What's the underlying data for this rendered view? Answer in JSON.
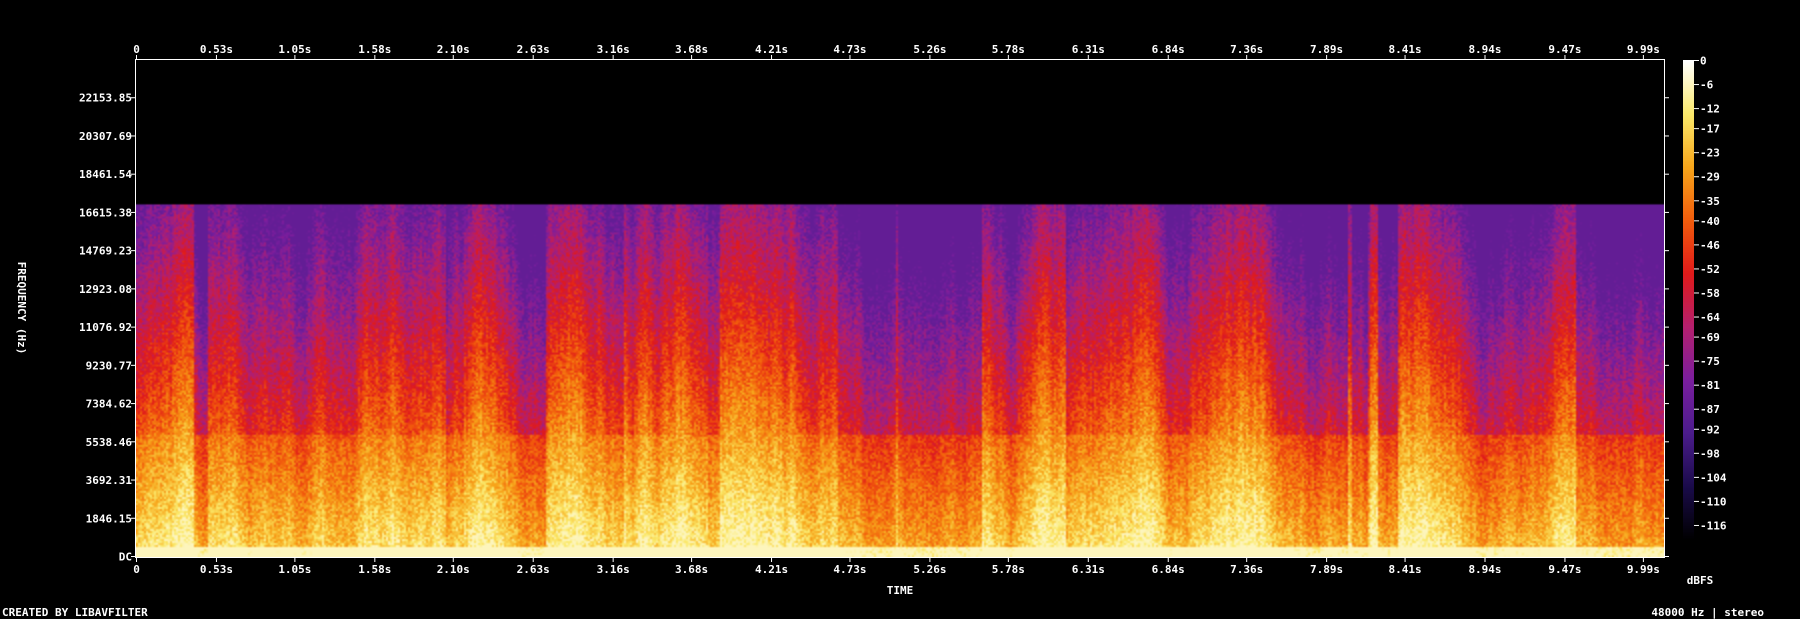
{
  "chart_data": {
    "type": "heatmap",
    "xlabel": "TIME",
    "ylabel": "FREQUENCY (Hz)",
    "x_ticks": [
      "0",
      "0.53s",
      "1.05s",
      "1.58s",
      "2.10s",
      "2.63s",
      "3.16s",
      "3.68s",
      "4.21s",
      "4.73s",
      "5.26s",
      "5.78s",
      "6.31s",
      "6.84s",
      "7.36s",
      "7.89s",
      "8.41s",
      "8.94s",
      "9.47s",
      "9.99s"
    ],
    "x_tick_values": [
      0,
      0.53,
      1.05,
      1.58,
      2.1,
      2.63,
      3.16,
      3.68,
      4.21,
      4.73,
      5.26,
      5.78,
      6.31,
      6.84,
      7.36,
      7.89,
      8.41,
      8.94,
      9.47,
      9.99
    ],
    "x_range": [
      0,
      10.13
    ],
    "y_ticks": [
      "DC",
      "1846.15",
      "3692.31",
      "5538.46",
      "7384.62",
      "9230.77",
      "11076.92",
      "12923.08",
      "14769.23",
      "16615.38",
      "18461.54",
      "20307.69",
      "22153.85"
    ],
    "y_tick_values": [
      0,
      1846.15,
      3692.31,
      5538.46,
      7384.62,
      9230.77,
      11076.92,
      12923.08,
      14769.23,
      16615.38,
      18461.54,
      20307.69,
      22153.85
    ],
    "y_range": [
      0,
      24000
    ],
    "cutoff_frequency": 17000,
    "color_scale": {
      "unit": "dBFS",
      "ticks": [
        "0",
        "-6",
        "-12",
        "-17",
        "-23",
        "-29",
        "-35",
        "-40",
        "-46",
        "-52",
        "-58",
        "-64",
        "-69",
        "-75",
        "-81",
        "-87",
        "-92",
        "-98",
        "-104",
        "-110",
        "-116"
      ],
      "tick_values": [
        0,
        -6,
        -12,
        -17,
        -23,
        -29,
        -35,
        -40,
        -46,
        -52,
        -58,
        -64,
        -69,
        -75,
        -81,
        -87,
        -92,
        -98,
        -104,
        -110,
        -116
      ],
      "range": [
        -120,
        0
      ],
      "colors": [
        "#000000",
        "#1a0b4a",
        "#4b1c8c",
        "#7a1e9e",
        "#b41f6e",
        "#e01a1a",
        "#f25c0c",
        "#f7a51a",
        "#fbe96a",
        "#ffffff"
      ]
    }
  },
  "footer": {
    "credit": "CREATED BY LIBAVFILTER",
    "format": "48000 Hz | stereo"
  }
}
